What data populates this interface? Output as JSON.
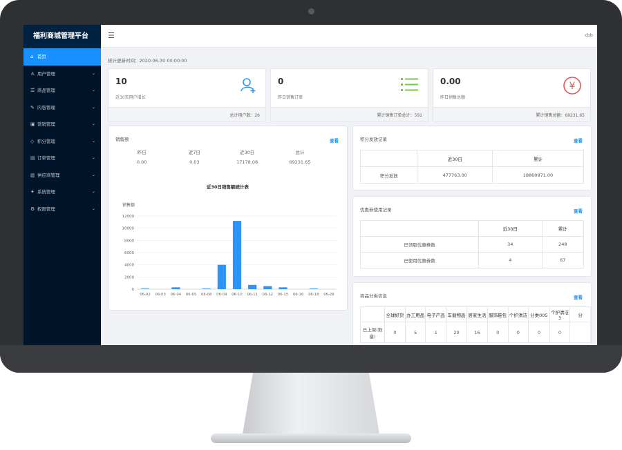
{
  "app": {
    "title": "福利商城管理平台",
    "user": "cbb",
    "menu_icon": "menu-fold-icon"
  },
  "sidebar": {
    "items": [
      {
        "label": "首页",
        "icon": "home-icon",
        "active": true
      },
      {
        "label": "用户管理",
        "icon": "user-icon"
      },
      {
        "label": "商品管理",
        "icon": "list-icon"
      },
      {
        "label": "内容管理",
        "icon": "edit-icon"
      },
      {
        "label": "营销管理",
        "icon": "gift-icon"
      },
      {
        "label": "积分管理",
        "icon": "tag-icon"
      },
      {
        "label": "订单管理",
        "icon": "order-icon"
      },
      {
        "label": "供应商管理",
        "icon": "supplier-icon"
      },
      {
        "label": "系统管理",
        "icon": "wrench-icon"
      },
      {
        "label": "权限管理",
        "icon": "gear-icon"
      }
    ]
  },
  "update_time": "统计更新时间：2020-06-30 00:00:00",
  "stats": [
    {
      "value": "10",
      "label": "近30天用户增长",
      "footer": "总计用户数：26",
      "icon": "user-add-icon"
    },
    {
      "value": "0",
      "label": "昨日销售订单",
      "footer": "累计销售订单总计：591",
      "icon": "list-icon"
    },
    {
      "value": "0.00",
      "label": "昨日销售总额",
      "footer": "累计销售总额：69231.65",
      "icon": "yen-icon"
    }
  ],
  "sales": {
    "title": "销售额",
    "link": "查看",
    "headers": [
      "昨日",
      "近7日",
      "近30日",
      "总计"
    ],
    "values": [
      "0.00",
      "0.03",
      "17178.08",
      "69231.65"
    ]
  },
  "chart_data": {
    "type": "bar",
    "title": "近30日销售额统计表",
    "ylabel": "销售额",
    "categories": [
      "06-02",
      "06-03",
      "06-04",
      "06-05",
      "06-08",
      "06-09",
      "06-10",
      "06-11",
      "06-12",
      "06-15",
      "06-16",
      "06-18",
      "06-28"
    ],
    "values": [
      100,
      0,
      300,
      0,
      100,
      4000,
      11200,
      700,
      500,
      300,
      0,
      100,
      0
    ],
    "ylim": [
      0,
      12000
    ],
    "yticks": [
      "12000",
      "10000",
      "8000",
      "6000",
      "4000",
      "2000",
      "0"
    ],
    "grid": true,
    "color": "#2f93f5"
  },
  "points": {
    "title": "积分发放记录",
    "link": "查看",
    "headers": [
      "",
      "近30日",
      "累计"
    ],
    "rows": [
      [
        "积分发放",
        "477763.00",
        "18860971.00"
      ]
    ]
  },
  "coupons": {
    "title": "优惠券使用记录",
    "link": "查看",
    "headers": [
      "",
      "近30日",
      "累计"
    ],
    "rows": [
      [
        "已领取优惠券数",
        "34",
        "248"
      ],
      [
        "已使用优惠券数",
        "4",
        "67"
      ]
    ]
  },
  "categories": {
    "title": "商品分类信息",
    "link": "查看",
    "headers": [
      "",
      "全球好货",
      "办工用品",
      "电子产品",
      "车载物品",
      "居家生活",
      "服饰鞋包",
      "个护清洁",
      "分类005",
      "个护清洁3",
      "分"
    ],
    "rows": [
      [
        "已上架(数量)",
        "0",
        "5",
        "1",
        "20",
        "16",
        "0",
        "0",
        "0",
        "0",
        ""
      ]
    ]
  }
}
